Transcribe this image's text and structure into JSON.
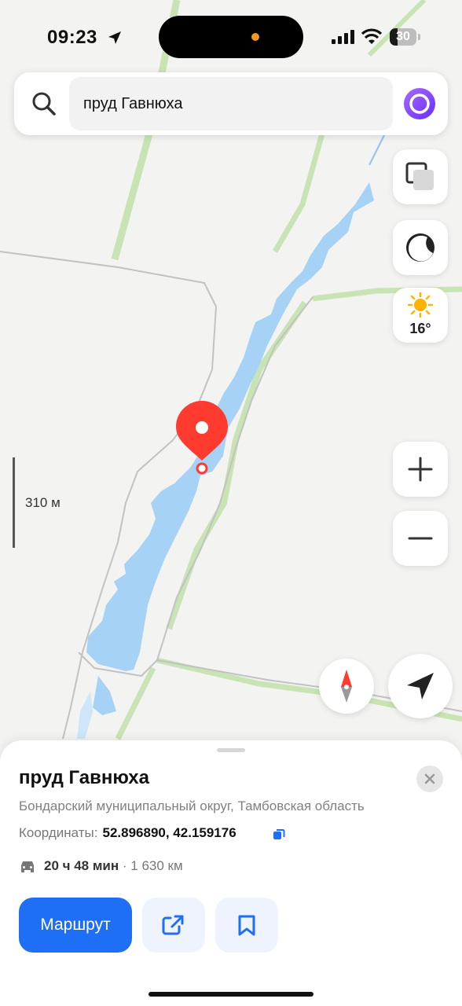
{
  "status_bar": {
    "time": "09:23",
    "battery_level": "30",
    "battery_fraction": 0.3
  },
  "search": {
    "query": "пруд Гавнюха",
    "icon": "search-icon",
    "assistant_icon": "alice-icon"
  },
  "map_controls": {
    "weather_temp": "16°",
    "weather_icon": "sun-icon",
    "layers_icon": "layers-icon",
    "theme_icon": "theme-icon",
    "zoom_in_icon": "plus-icon",
    "zoom_out_icon": "minus-icon",
    "compass_icon": "compass-icon",
    "location_icon": "navigation-arrow-icon"
  },
  "map": {
    "scale_label": "310 м",
    "pin_icon": "map-pin-icon"
  },
  "colors": {
    "water": "#a6d2f6",
    "field_border": "#c9e4b4",
    "pin": "#ff3b30",
    "accent": "#1e6ff5",
    "assistant": "#7a3cff"
  },
  "place_card": {
    "title": "пруд Гавнюха",
    "address": "Бондарский муниципальный округ, Тамбовская область",
    "coords_label": "Координаты:",
    "coords_value": "52.896890, 42.159176",
    "travel_time": "20 ч 48 мин",
    "travel_distance": "· 1 630 км",
    "route_button": "Маршрут",
    "share_icon": "share-icon",
    "bookmark_icon": "bookmark-icon",
    "close_icon": "close-icon",
    "car_icon": "car-icon",
    "copy_icon": "copy-icon"
  }
}
